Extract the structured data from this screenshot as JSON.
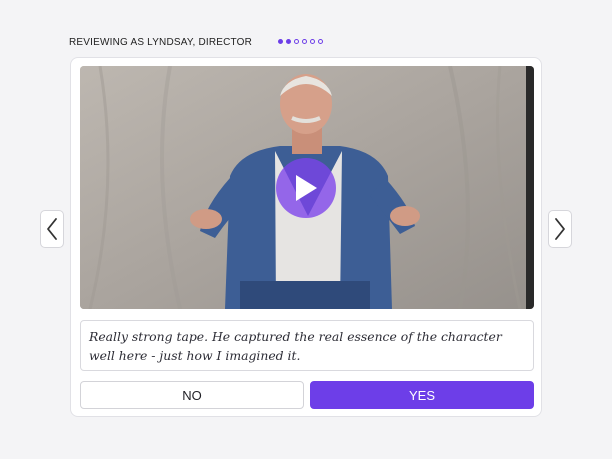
{
  "header": {
    "reviewer_label": "REVIEWING AS LYNDSAY, DIRECTOR",
    "pager": {
      "total": 6,
      "current": 2,
      "filled_dots": 2
    }
  },
  "video": {
    "play_icon": "play-icon"
  },
  "comment": {
    "text": "Really strong tape. He captured the real essence of the character well here - just how I imagined it."
  },
  "actions": {
    "no_label": "NO",
    "yes_label": "YES"
  },
  "navigation": {
    "prev_icon": "chevron-left-icon",
    "next_icon": "chevron-right-icon"
  },
  "colors": {
    "accent": "#6d3ee8",
    "background": "#f4f4f6"
  }
}
